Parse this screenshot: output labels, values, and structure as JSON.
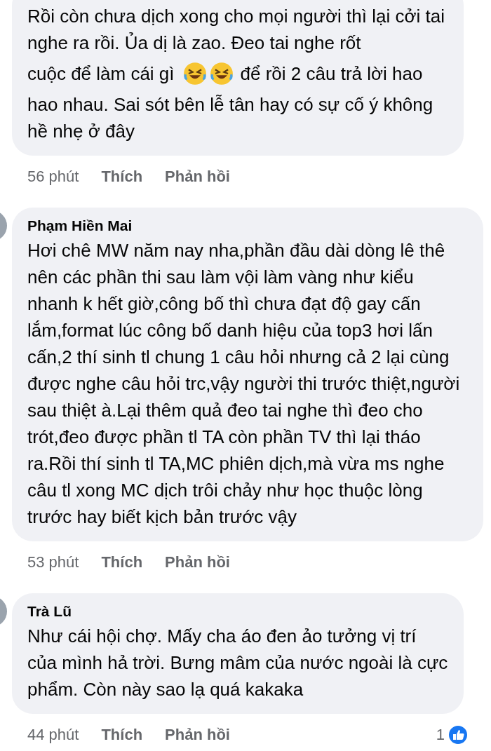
{
  "comments": [
    {
      "body": [
        {
          "kind": "text",
          "text": "Rồi còn chưa dịch xong cho mọi người thì lại cởi tai nghe ra rồi. Ủa dị là zao. Đeo tai nghe rốt"
        },
        {
          "kind": "row",
          "parts": [
            {
              "kind": "text",
              "text": "cuộc để làm cái gì"
            },
            {
              "kind": "emoji"
            },
            {
              "kind": "emoji"
            },
            {
              "kind": "text",
              "text": "để rồi 2 câu trả lời hao"
            }
          ]
        },
        {
          "kind": "text",
          "text": "hao nhau. Sai sót bên lễ tân hay có sự cố ý không hề nhẹ ở đây"
        }
      ],
      "time": "56 phút",
      "like": "Thích",
      "reply": "Phản hồi"
    },
    {
      "author": "Phạm Hiền Mai",
      "body": [
        {
          "kind": "text",
          "text": "Hơi chê MW năm nay nha,phần đầu dài dòng lê thê nên các phần thi sau làm vội làm vàng như kiểu nhanh k hết giờ,công bố thì chưa đạt độ gay cấn lắm,format lúc công bố danh hiệu của top3 hơi lấn cấn,2 thí sinh tl chung 1 câu hỏi nhưng cả 2 lại cùng được nghe câu hỏi trc,vậy người thi trước thiệt,người sau thiệt à.Lại thêm quả đeo tai nghe thì đeo cho trót,đeo được phần tl TA còn phần TV thì lại tháo ra.Rồi thí sinh tl TA,MC phiên dịch,mà vừa ms nghe câu tl xong MC dịch trôi chảy như học thuộc lòng trước hay biết kịch bản trước vậy"
        }
      ],
      "time": "53 phút",
      "like": "Thích",
      "reply": "Phản hồi"
    },
    {
      "author": "Trà Lũ",
      "body": [
        {
          "kind": "text",
          "text": "Như cái hội chợ. Mấy cha áo đen ảo tưởng vị trí của mình hả trời. Bưng mâm của nước ngoài là cực phẩm. Còn này sao lạ quá kakaka"
        }
      ],
      "time": "44 phút",
      "like": "Thích",
      "reply": "Phản hồi",
      "reactions": "1"
    }
  ]
}
